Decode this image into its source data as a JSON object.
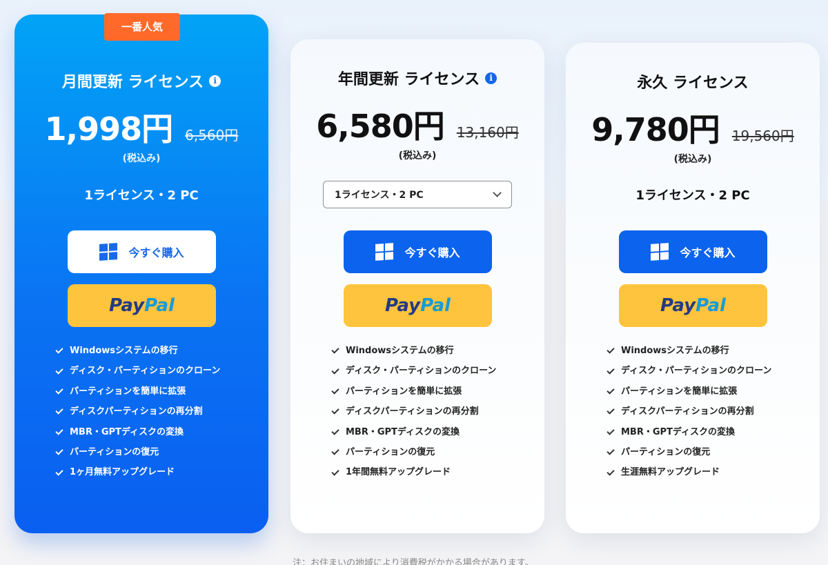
{
  "plans": [
    {
      "badge": "一番人気",
      "title": "月間更新 ライセンス",
      "price": "1,998円",
      "old_price": "6,560円",
      "tax": "(税込み)",
      "license": "1ライセンス・2 PC",
      "buy_label": "今すぐ購入",
      "paypal_1": "Pay",
      "paypal_2": "Pal",
      "features": [
        "Windowsシステムの移行",
        "ディスク・パーティションのクローン",
        "パーティションを簡単に拡張",
        "ディスクパーティションの再分割",
        "MBR・GPTディスクの変換",
        "パーティションの復元",
        "1ヶ月無料アップグレード"
      ]
    },
    {
      "title": "年間更新 ライセンス",
      "price": "6,580円",
      "old_price": "13,160円",
      "tax": "(税込み)",
      "license_select": "1ライセンス・2 PC",
      "buy_label": "今すぐ購入",
      "paypal_1": "Pay",
      "paypal_2": "Pal",
      "features": [
        "Windowsシステムの移行",
        "ディスク・パーティションのクローン",
        "パーティションを簡単に拡張",
        "ディスクパーティションの再分割",
        "MBR・GPTディスクの変換",
        "パーティションの復元",
        "1年間無料アップグレード"
      ]
    },
    {
      "title": "永久 ライセンス",
      "price": "9,780円",
      "old_price": "19,560円",
      "tax": "(税込み)",
      "license": "1ライセンス・2 PC",
      "buy_label": "今すぐ購入",
      "paypal_1": "Pay",
      "paypal_2": "Pal",
      "features": [
        "Windowsシステムの移行",
        "ディスク・パーティションのクローン",
        "パーティションを簡単に拡張",
        "ディスクパーティションの再分割",
        "MBR・GPTディスクの変換",
        "パーティションの復元",
        "生涯無料アップグレード"
      ]
    }
  ],
  "info_glyph": "i",
  "note": "注：お住まいの地域により消費税がかかる場合があります。",
  "colors": {
    "featured_top": "#02a3f6",
    "featured_bottom": "#0a5ff0",
    "badge": "#ff6a2b",
    "buy_blue": "#0b63ee",
    "paypal_yellow": "#ffc43d"
  }
}
